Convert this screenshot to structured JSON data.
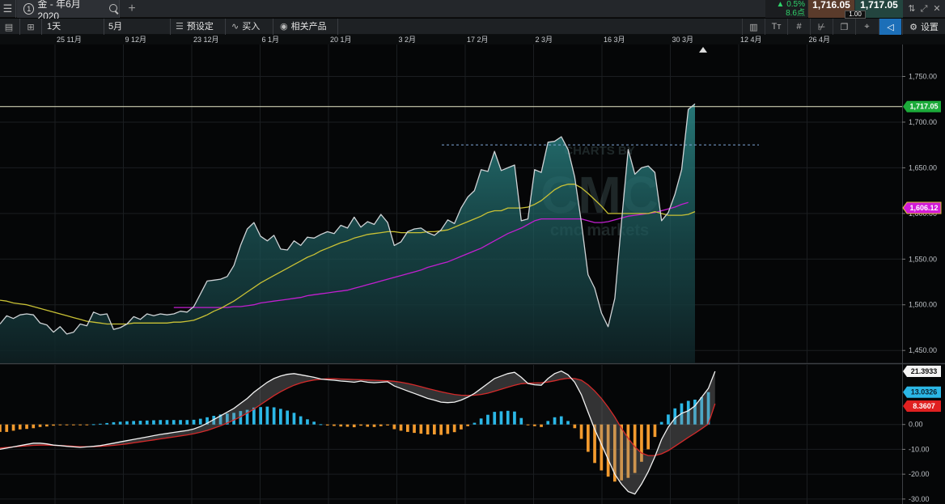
{
  "topbar": {
    "menu_icon": "hamburger-icon",
    "instrument_number": "1",
    "instrument_name": "金 - 年6月 2020",
    "change_pct": "▲ 0.5%",
    "change_pts": "8.6点",
    "bid": "1,716.05",
    "ask": "1,717.05",
    "spread": "1.00"
  },
  "toolbar": {
    "interval": "1天",
    "range": "5月",
    "preset_label": "预设定",
    "buy_label": "买入",
    "related_label": "相关产品",
    "settings_label": "设置"
  },
  "colors": {
    "price_line": "#cfd3d6",
    "price_fill": "#1f6a6b",
    "ma_short": "#c9c135",
    "ma_long": "#c21fd0",
    "macd_line": "#f2f2f2",
    "signal_line": "#d42a2a",
    "hist_pos": "#2bb7e6",
    "hist_neg": "#f29a2e",
    "current_price": "#1cab3a"
  },
  "watermark": {
    "line1": "CHARTS BY",
    "line2": "CMC",
    "line3": "cmc markets"
  },
  "chart_data": [
    {
      "type": "area",
      "title": "",
      "x_ticks": [
        "25 11月",
        "9 12月",
        "23 12月",
        "6 1月",
        "20 1月",
        "3 2月",
        "17 2月",
        "2 3月",
        "16 3月",
        "30 3月",
        "12 4月",
        "26 4月"
      ],
      "y_ticks": [
        1750,
        1700,
        1650,
        1600,
        1550,
        1500,
        1450
      ],
      "y_tick_labels": [
        "1,750.00",
        "1,700.00",
        "1,650.00",
        "1,600.00",
        "1,550.00",
        "1,500.00",
        "1,450.00"
      ],
      "ylim": [
        1436,
        1785
      ],
      "current_price": 1717.05,
      "current_price_label": "1,717.05",
      "ma_label": "1,606.12",
      "resistance_level": 1675,
      "series": [
        {
          "role": "price",
          "values": [
            1479,
            1488,
            1485,
            1489,
            1490,
            1489,
            1480,
            1478,
            1470,
            1476,
            1468,
            1470,
            1479,
            1477,
            1492,
            1489,
            1490,
            1473,
            1475,
            1479,
            1487,
            1484,
            1490,
            1488,
            1490,
            1489,
            1490,
            1493,
            1492,
            1498,
            1512,
            1526,
            1527,
            1528,
            1531,
            1543,
            1565,
            1583,
            1590,
            1575,
            1570,
            1576,
            1561,
            1560,
            1570,
            1565,
            1574,
            1573,
            1577,
            1580,
            1578,
            1587,
            1584,
            1596,
            1585,
            1591,
            1588,
            1599,
            1590,
            1565,
            1569,
            1580,
            1583,
            1584,
            1579,
            1576,
            1582,
            1593,
            1589,
            1606,
            1618,
            1625,
            1648,
            1646,
            1668,
            1647,
            1650,
            1653,
            1592,
            1594,
            1648,
            1645,
            1678,
            1679,
            1684,
            1670,
            1640,
            1590,
            1533,
            1518,
            1491,
            1476,
            1507,
            1590,
            1670,
            1643,
            1650,
            1652,
            1645,
            1592,
            1601,
            1621,
            1648,
            1714,
            1720
          ]
        },
        {
          "role": "ma_short",
          "values": [
            1505,
            1504,
            1502,
            1501,
            1500,
            1498,
            1496,
            1494,
            1492,
            1490,
            1488,
            1486,
            1484,
            1482,
            1481,
            1480,
            1479,
            1479,
            1479,
            1479,
            1480,
            1480,
            1480,
            1480,
            1480,
            1480,
            1481,
            1481,
            1482,
            1483,
            1486,
            1489,
            1493,
            1496,
            1500,
            1504,
            1509,
            1514,
            1519,
            1524,
            1528,
            1532,
            1536,
            1540,
            1544,
            1548,
            1552,
            1555,
            1559,
            1562,
            1565,
            1568,
            1570,
            1573,
            1575,
            1577,
            1578,
            1579,
            1580,
            1580,
            1579,
            1579,
            1579,
            1579,
            1580,
            1580,
            1581,
            1582,
            1585,
            1588,
            1591,
            1594,
            1597,
            1601,
            1603,
            1603,
            1606,
            1606,
            1606,
            1607,
            1610,
            1614,
            1620,
            1626,
            1630,
            1632,
            1632,
            1628,
            1622,
            1615,
            1608,
            1600,
            1600,
            1600,
            1600,
            1600,
            1600,
            1600,
            1602,
            1600,
            1598,
            1598,
            1598,
            1599,
            1602
          ]
        },
        {
          "role": "ma_long",
          "start_index": 26,
          "values": [
            1497,
            1497,
            1497,
            1497,
            1497,
            1497,
            1497,
            1497,
            1497,
            1498,
            1498,
            1499,
            1500,
            1502,
            1503,
            1504,
            1505,
            1506,
            1507,
            1508,
            1510,
            1511,
            1512,
            1513,
            1514,
            1515,
            1516,
            1518,
            1520,
            1522,
            1524,
            1526,
            1528,
            1530,
            1532,
            1534,
            1536,
            1538,
            1541,
            1543,
            1545,
            1547,
            1550,
            1553,
            1556,
            1559,
            1562,
            1566,
            1570,
            1574,
            1578,
            1581,
            1584,
            1588,
            1592,
            1594,
            1594,
            1594,
            1594,
            1594,
            1594,
            1594,
            1592,
            1590,
            1590,
            1591,
            1593,
            1595,
            1597,
            1598,
            1599,
            1600,
            1601,
            1603,
            1605,
            1607,
            1610,
            1612
          ]
        }
      ]
    },
    {
      "type": "bar",
      "title": "",
      "y_ticks": [
        0,
        -10,
        -20,
        -30
      ],
      "y_tick_labels": [
        "0.00",
        "-10.00",
        "-20.00",
        "-30.00"
      ],
      "ylim": [
        -32,
        24
      ],
      "label_macd": "21.3933",
      "label_hist": "13.0326",
      "label_signal": "8.3607",
      "series": [
        {
          "role": "macd",
          "values": [
            -10,
            -9.5,
            -9,
            -8.5,
            -8,
            -7.5,
            -7.5,
            -7.8,
            -8.3,
            -8.5,
            -8.8,
            -9,
            -9.2,
            -9,
            -8.8,
            -8.5,
            -8,
            -7.5,
            -7,
            -6.5,
            -6,
            -5.5,
            -5,
            -4.5,
            -4,
            -3.6,
            -3.2,
            -2.8,
            -2.4,
            -1.8,
            -0.8,
            0.5,
            2,
            3.5,
            5,
            6.5,
            8.5,
            10.5,
            13,
            15,
            17,
            18.5,
            19.5,
            20.2,
            20.5,
            20,
            19.5,
            19,
            18.3,
            18,
            17.8,
            17.5,
            17.3,
            17,
            17.5,
            17,
            16.8,
            17,
            17.2,
            15.5,
            14.5,
            13.5,
            12.5,
            11.5,
            10.5,
            9.8,
            9,
            8.8,
            9,
            9.8,
            11,
            12.5,
            14.5,
            16.5,
            18.5,
            19.5,
            20.5,
            21,
            19,
            16.5,
            16,
            15.8,
            18.5,
            20.5,
            21.5,
            20,
            17,
            12,
            5,
            -2,
            -8,
            -14,
            -20,
            -24,
            -27,
            -28,
            -24,
            -19,
            -13,
            -6,
            -1,
            2.5,
            4.5,
            5.5,
            7.5,
            11,
            14.5,
            21.4
          ]
        },
        {
          "role": "signal",
          "values": [
            -9.5,
            -9.2,
            -9,
            -8.8,
            -8.6,
            -8.4,
            -8.3,
            -8.3,
            -8.4,
            -8.5,
            -8.6,
            -8.8,
            -8.9,
            -8.9,
            -8.9,
            -8.8,
            -8.6,
            -8.4,
            -8.1,
            -7.8,
            -7.4,
            -7,
            -6.6,
            -6.2,
            -5.8,
            -5.4,
            -5,
            -4.6,
            -4.2,
            -3.7,
            -3.1,
            -2.4,
            -1.5,
            -0.5,
            0.6,
            1.8,
            3.1,
            4.6,
            6.2,
            8,
            9.8,
            11.6,
            13.2,
            14.6,
            15.8,
            16.7,
            17.4,
            17.9,
            18.2,
            18.4,
            18.4,
            18.3,
            18.2,
            18.1,
            18,
            17.9,
            17.8,
            17.7,
            17.6,
            17.4,
            17,
            16.5,
            15.9,
            15.2,
            14.5,
            13.8,
            13.2,
            12.6,
            12.1,
            11.8,
            11.7,
            11.8,
            12.1,
            12.6,
            13.4,
            14.2,
            15,
            15.8,
            16.4,
            16.6,
            16.7,
            16.8,
            17.1,
            17.6,
            18.2,
            18.6,
            18.5,
            17.8,
            16,
            13.5,
            10.5,
            7,
            3,
            -1.5,
            -5.5,
            -9,
            -11.5,
            -12.5,
            -12.5,
            -11.8,
            -10.5,
            -8.8,
            -7,
            -5.2,
            -3.5,
            -1.7,
            0.2,
            8.36
          ]
        },
        {
          "role": "histogram",
          "values": [
            -3,
            -3,
            -2.5,
            -2,
            -1.8,
            -1.5,
            -1,
            -0.8,
            -0.5,
            -0.3,
            -0.3,
            -0.3,
            -0.3,
            -0.1,
            0.1,
            0.3,
            0.6,
            0.9,
            1.1,
            1.3,
            1.4,
            1.5,
            1.6,
            1.7,
            1.8,
            1.8,
            1.8,
            1.8,
            1.8,
            1.9,
            2.3,
            2.9,
            3.5,
            4,
            4.4,
            4.7,
            5.4,
            5.9,
            6.8,
            7,
            7.2,
            6.9,
            6.3,
            5.6,
            4.7,
            3.3,
            2.1,
            1.1,
            0.1,
            -0.4,
            -0.6,
            -0.8,
            -0.9,
            -1.1,
            -0.5,
            -0.9,
            -1,
            -0.7,
            -0.4,
            -1.9,
            -2.5,
            -3,
            -3.4,
            -3.7,
            -4,
            -4,
            -4.2,
            -3.8,
            -3.1,
            -2,
            -0.7,
            0.7,
            2.4,
            3.9,
            5.1,
            5.3,
            5.5,
            5.2,
            2.6,
            -0.1,
            -0.7,
            -1,
            1.4,
            2.9,
            3.3,
            1.4,
            -1.5,
            -5.8,
            -11,
            -15.5,
            -18.5,
            -21,
            -23,
            -22.5,
            -21.5,
            -19.5,
            -15,
            -10,
            -5,
            1,
            4,
            6.5,
            8.5,
            9.5,
            10,
            11,
            13.03
          ]
        }
      ]
    }
  ]
}
